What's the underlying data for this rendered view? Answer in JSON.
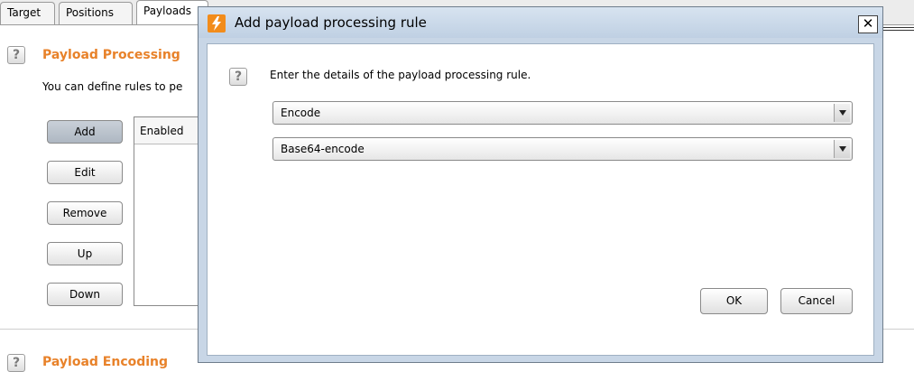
{
  "tabs": [
    "Target",
    "Positions",
    "Payloads"
  ],
  "background": {
    "section_title": "Payload Processing",
    "description": "You can define rules to pe",
    "buttons": [
      "Add",
      "Edit",
      "Remove",
      "Up",
      "Down"
    ],
    "table_header": "Enabled",
    "next_section_title": "Payload Encoding"
  },
  "dialog": {
    "title": "Add payload processing rule",
    "close_label": "✕",
    "prompt": "Enter the details of the payload processing rule.",
    "rule_type": "Encode",
    "rule_option": "Base64-encode",
    "ok_label": "OK",
    "cancel_label": "Cancel"
  },
  "help_icon_glyph": "?"
}
